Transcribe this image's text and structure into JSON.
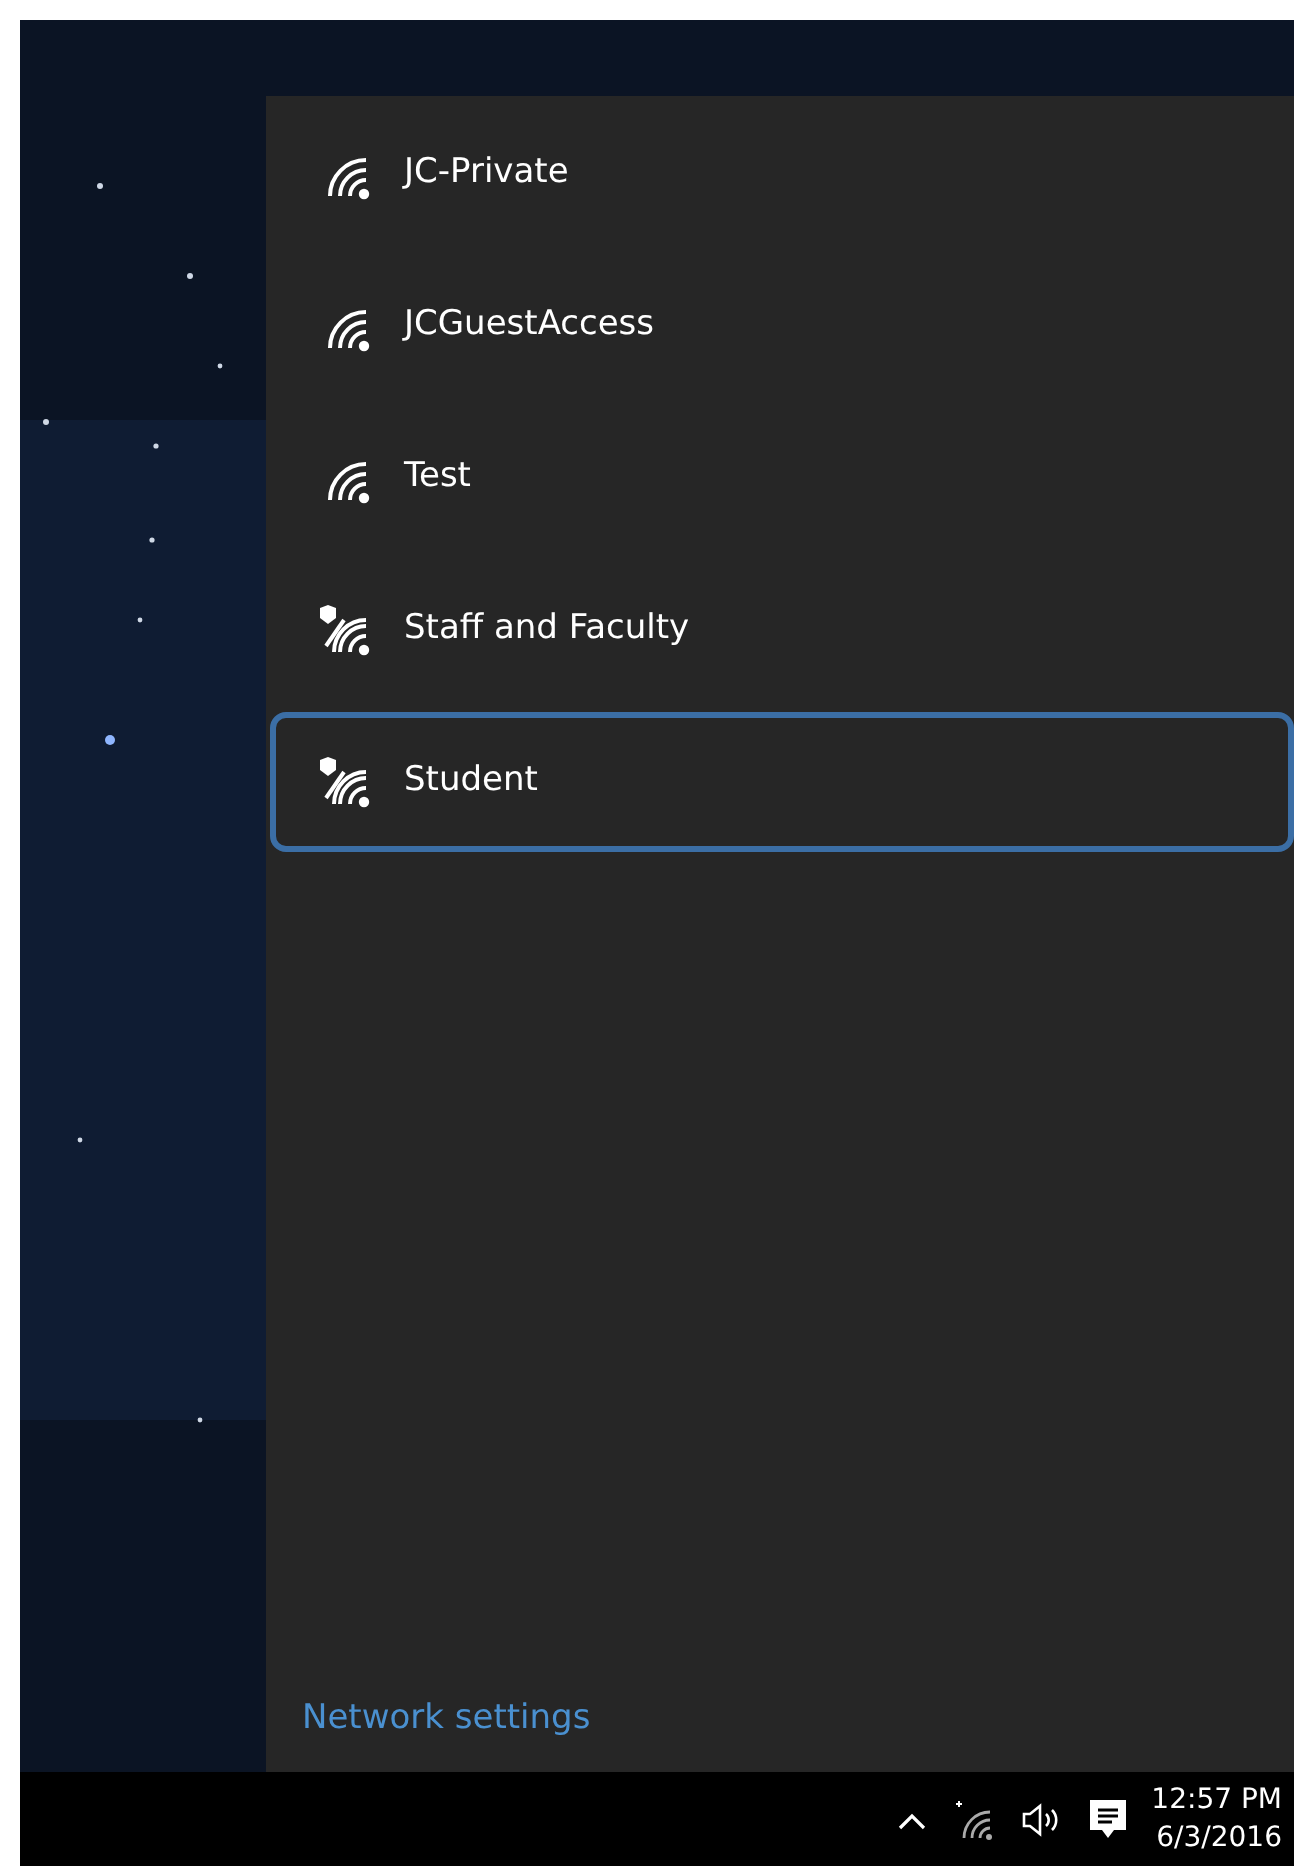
{
  "networks": [
    {
      "name": "JC-Private",
      "kind": "open",
      "selected": false
    },
    {
      "name": "JCGuestAccess",
      "kind": "open",
      "selected": false
    },
    {
      "name": "Test",
      "kind": "open",
      "selected": false
    },
    {
      "name": "Staff and Faculty",
      "kind": "secured",
      "selected": false
    },
    {
      "name": "Student",
      "kind": "secured",
      "selected": true
    }
  ],
  "settings_link": "Network settings",
  "taskbar": {
    "time": "12:57 PM",
    "date": "6/3/2016"
  }
}
